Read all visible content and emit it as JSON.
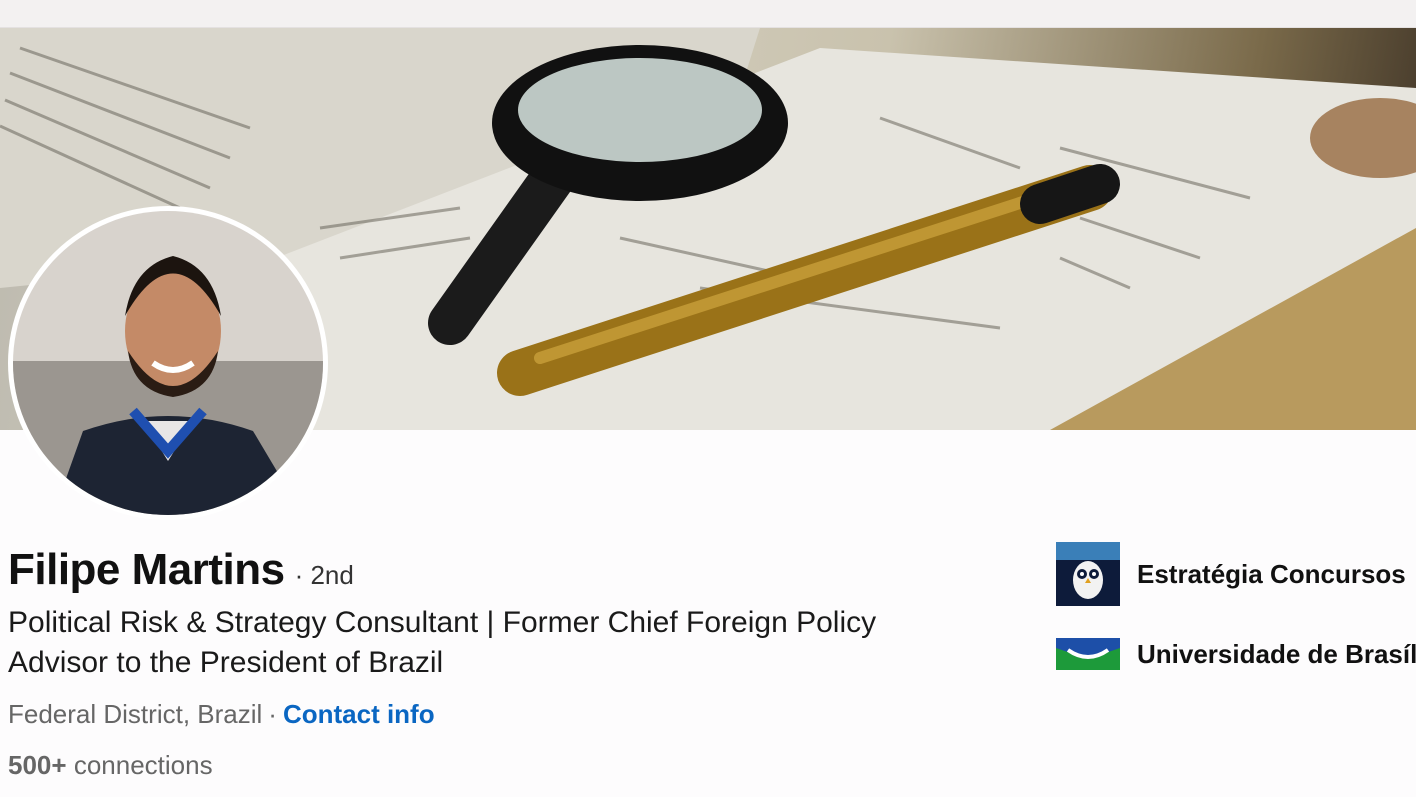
{
  "profile": {
    "name": "Filipe Martins",
    "degree": "· 2nd",
    "headline": "Political Risk & Strategy Consultant | Former Chief Foreign Policy Advisor to the President of Brazil",
    "location": "Federal District, Brazil",
    "separator": "·",
    "contact_label": "Contact info",
    "connections_count": "500+",
    "connections_label": "connections"
  },
  "experience": [
    {
      "name": "Estratégia Concursos",
      "logo": "owl-logo-icon"
    },
    {
      "name": "Universidade de Brasília",
      "logo": "university-flag-logo-icon"
    }
  ],
  "colors": {
    "link": "#0a66c2",
    "background": "#fdfcfd"
  }
}
